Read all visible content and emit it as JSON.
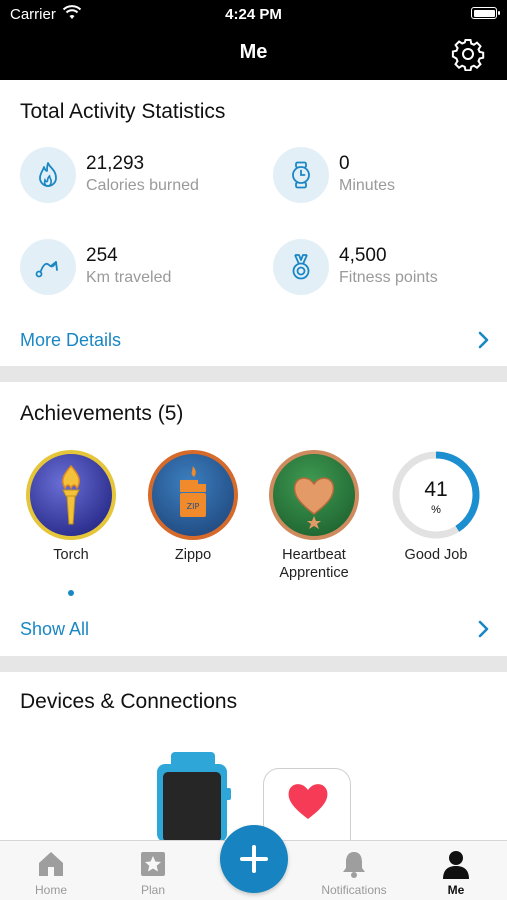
{
  "status_bar": {
    "carrier": "Carrier",
    "time": "4:24 PM"
  },
  "nav": {
    "title": "Me"
  },
  "activity": {
    "heading": "Total Activity Statistics",
    "stats": [
      {
        "icon": "flame-icon",
        "value": "21,293",
        "label": "Calories burned"
      },
      {
        "icon": "watch-icon",
        "value": "0",
        "label": "Minutes"
      },
      {
        "icon": "route-icon",
        "value": "254",
        "label": "Km traveled"
      },
      {
        "icon": "medal-icon",
        "value": "4,500",
        "label": "Fitness points"
      }
    ],
    "more_link": "More Details"
  },
  "achievements": {
    "heading": "Achievements (5)",
    "badges": [
      {
        "name": "Torch"
      },
      {
        "name": "Zippo"
      },
      {
        "name": "Heartbeat Apprentice"
      },
      {
        "name": "Good Job",
        "value": "41",
        "unit": "%",
        "progress": 0.41
      }
    ],
    "show_all": "Show All"
  },
  "devices": {
    "heading": "Devices & Connections"
  },
  "tabbar": {
    "tabs": [
      {
        "label": "Home",
        "icon": "home-icon"
      },
      {
        "label": "Plan",
        "icon": "plan-star-icon"
      },
      {
        "label": "Notifications",
        "icon": "bell-icon"
      },
      {
        "label": "Me",
        "icon": "person-icon",
        "active": true
      }
    ],
    "fab_icon": "plus-icon"
  },
  "colors": {
    "accent": "#1a87c4",
    "icon_bg": "#e3eff7",
    "progress_ring": "#1b8fd0"
  }
}
